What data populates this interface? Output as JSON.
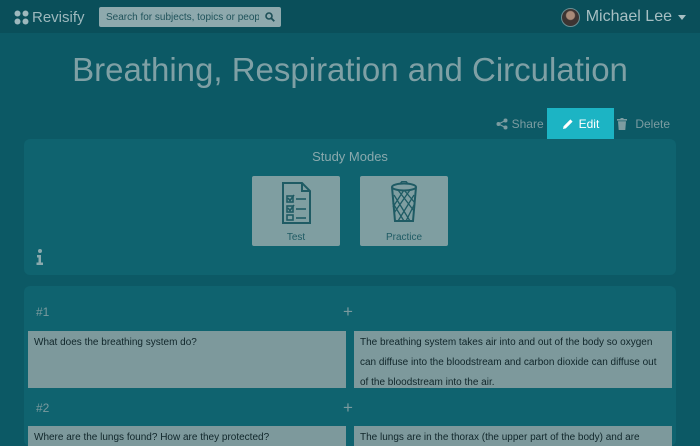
{
  "header": {
    "brand": "Revisify",
    "search_placeholder": "Search for subjects, topics or people",
    "user_name": "Michael Lee"
  },
  "page": {
    "title": "Breathing, Respiration and Circulation"
  },
  "actions": {
    "share": "Share",
    "edit": "Edit",
    "delete": "Delete"
  },
  "study_modes": {
    "title": "Study Modes",
    "modes": [
      {
        "label": "Test",
        "icon": "test-checklist-icon"
      },
      {
        "label": "Practice",
        "icon": "practice-basket-icon"
      }
    ]
  },
  "flashcards": [
    {
      "number": "#1",
      "question": "What does the breathing system do?",
      "answer": "The breathing system takes air into and out of the body so oxygen can diffuse into the bloodstream and carbon dioxide can diffuse out of the bloodstream into the air."
    },
    {
      "number": "#2",
      "question": "Where are the lungs found? How are they protected?",
      "answer": "The lungs are in the thorax (the upper part of the body) and are"
    }
  ],
  "colors": {
    "background": "#0c5965",
    "accent": "#1cb4c4"
  }
}
